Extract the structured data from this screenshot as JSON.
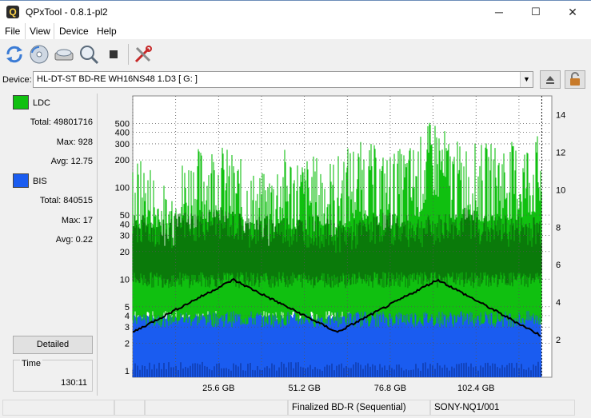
{
  "window": {
    "title": "QPxTool - 0.8.1-pl2",
    "app_icon_letter": "Q",
    "controls": [
      "─",
      "☐",
      "✕"
    ]
  },
  "menu": [
    "File",
    "View",
    "Device",
    "Help"
  ],
  "toolbar": {
    "icons": [
      "refresh-icon",
      "disc-scan-icon",
      "drive-eject-icon",
      "magnifier-icon",
      "stop-icon",
      "tools-icon"
    ]
  },
  "device": {
    "label": "Device:",
    "value": "HL-DT-ST BD-RE  WH16NS48  1.D3 [ G: ]"
  },
  "ldc": {
    "name": "LDC",
    "color": "#10c010",
    "total_label": "Total:",
    "total": "49801716",
    "max_label": "Max:",
    "max": "928",
    "avg_label": "Avg:",
    "avg": "12.75"
  },
  "bis": {
    "name": "BIS",
    "color": "#1a5cf0",
    "total_label": "Total:",
    "total": "840515",
    "max_label": "Max:",
    "max": "17",
    "avg_label": "Avg:",
    "avg": "0.22"
  },
  "detailed_button": "Detailed",
  "time": {
    "label": "Time",
    "value": "130:11"
  },
  "status": {
    "disc_type": "Finalized BD-R (Sequential)",
    "media_id": "SONY-NQ1/001"
  },
  "chart_data": {
    "type": "area",
    "x_unit": "GB",
    "xlim": [
      0,
      125
    ],
    "x_ticks": [
      25.6,
      51.2,
      76.8,
      102.4
    ],
    "x_tick_labels": [
      "25.6 GB",
      "51.2 GB",
      "76.8 GB",
      "102.4 GB"
    ],
    "y_left_scale": "log",
    "y_left_ticks": [
      1,
      2,
      3,
      4,
      5,
      10,
      20,
      30,
      40,
      50,
      100,
      200,
      300,
      400,
      500
    ],
    "y_right_ticks": [
      2,
      4,
      6,
      8,
      10,
      12,
      14
    ],
    "y_right_lim": [
      0,
      15
    ],
    "grid": true,
    "series": [
      {
        "name": "LDC",
        "color": "#10c010",
        "x": [
          0,
          5,
          10,
          15,
          20,
          25,
          30,
          35,
          40,
          45,
          50,
          55,
          60,
          65,
          70,
          75,
          80,
          85,
          90,
          95,
          100,
          105,
          110,
          115,
          120,
          122
        ],
        "peak": [
          200,
          180,
          90,
          200,
          260,
          300,
          220,
          150,
          130,
          250,
          200,
          210,
          190,
          280,
          300,
          220,
          250,
          300,
          550,
          300,
          290,
          280,
          300,
          290,
          340,
          350
        ],
        "base": [
          40,
          40,
          35,
          45,
          45,
          50,
          45,
          40,
          40,
          40,
          40,
          40,
          35,
          35,
          40,
          45,
          40,
          40,
          40,
          45,
          50,
          40,
          40,
          40,
          40,
          40
        ]
      },
      {
        "name": "BIS",
        "color": "#1a5cf0",
        "x": [
          0,
          10,
          20,
          30,
          40,
          50,
          60,
          70,
          80,
          90,
          100,
          110,
          122
        ],
        "level": [
          4,
          4,
          4,
          5,
          4,
          4,
          4,
          5,
          5,
          6,
          6,
          5,
          6
        ]
      },
      {
        "name": "Speed",
        "color": "#000000",
        "x": [
          0,
          30,
          61,
          91,
          122
        ],
        "y": [
          2.4,
          5.2,
          2.4,
          5.2,
          2.2
        ]
      }
    ]
  }
}
